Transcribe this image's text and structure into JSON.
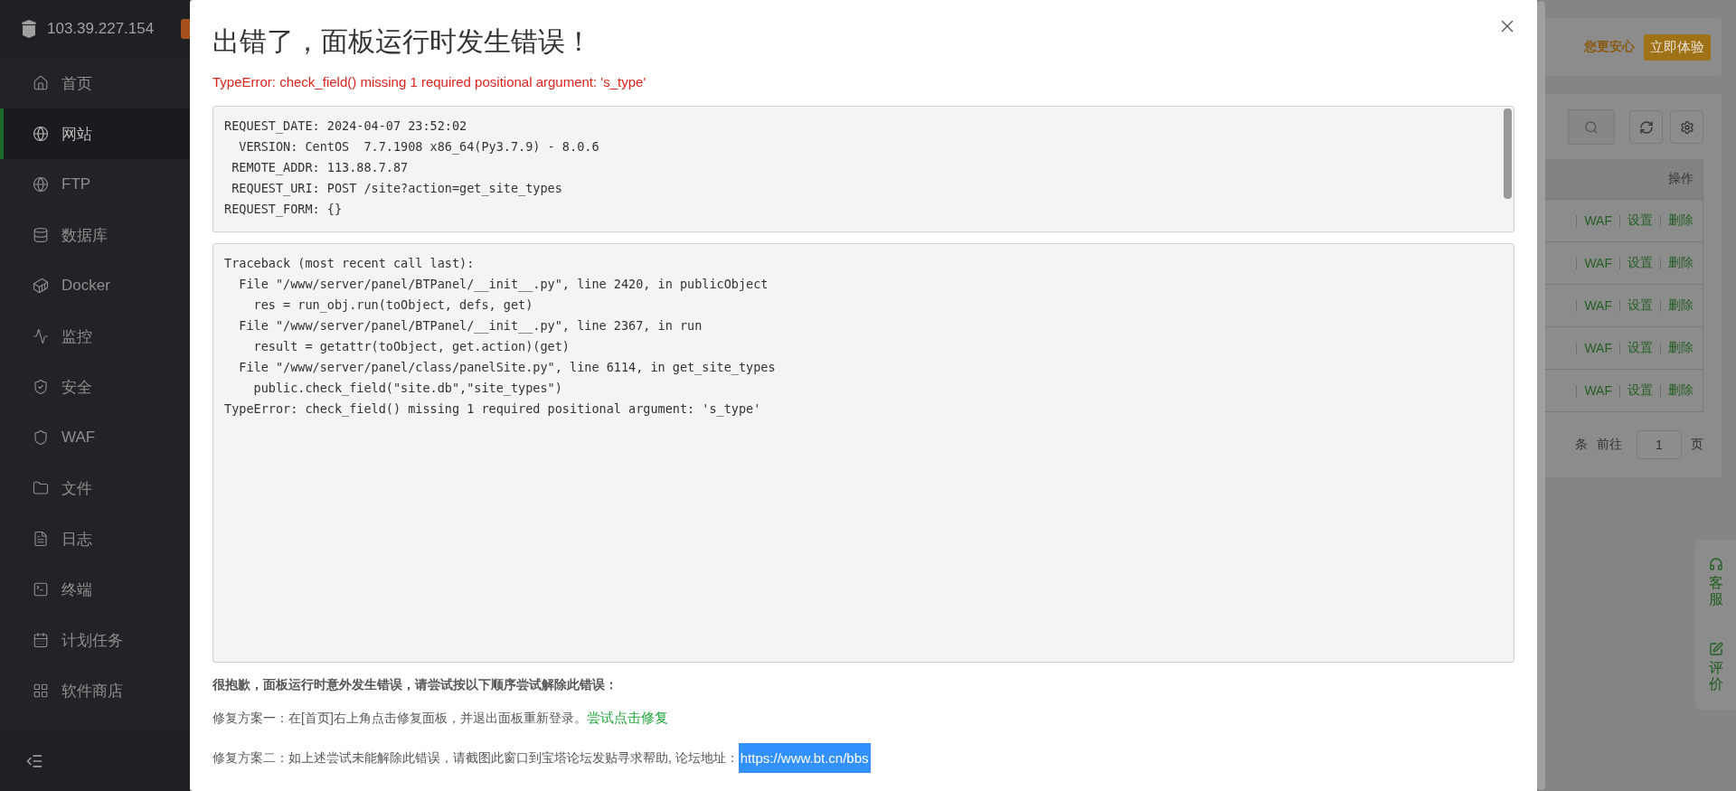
{
  "sidebar": {
    "host": "103.39.227.154",
    "items": [
      {
        "label": "首页",
        "selected": false
      },
      {
        "label": "网站",
        "selected": true
      },
      {
        "label": "FTP",
        "selected": false
      },
      {
        "label": "数据库",
        "selected": false
      },
      {
        "label": "Docker",
        "selected": false
      },
      {
        "label": "监控",
        "selected": false
      },
      {
        "label": "安全",
        "selected": false
      },
      {
        "label": "WAF",
        "selected": false
      },
      {
        "label": "文件",
        "selected": false
      },
      {
        "label": "日志",
        "selected": false
      },
      {
        "label": "终端",
        "selected": false
      },
      {
        "label": "计划任务",
        "selected": false
      },
      {
        "label": "软件商店",
        "selected": false
      }
    ]
  },
  "banner": {
    "text": "您更安心",
    "button": "立即体验"
  },
  "table": {
    "header": "操作",
    "rows": [
      {
        "actions": [
          "WAF",
          "设置",
          "删除"
        ]
      },
      {
        "actions": [
          "WAF",
          "设置",
          "删除"
        ]
      },
      {
        "actions": [
          "WAF",
          "设置",
          "删除"
        ]
      },
      {
        "actions": [
          "WAF",
          "设置",
          "删除"
        ]
      },
      {
        "actions": [
          "WAF",
          "设置",
          "删除"
        ]
      }
    ]
  },
  "pagination": {
    "unit": "条",
    "goto": "前往",
    "page": "1",
    "page_suffix": "页"
  },
  "float_panel": [
    {
      "label": "客服"
    },
    {
      "label": "评价"
    }
  ],
  "modal": {
    "title": "出错了，面板运行时发生错误！",
    "error": "TypeError: check_field() missing 1 required positional argument: 's_type'",
    "request_info": [
      "REQUEST_DATE: 2024-04-07 23:52:02",
      "  VERSION: CentOS  7.7.1908 x86_64(Py3.7.9) - 8.0.6",
      " REMOTE_ADDR: 113.88.7.87",
      " REQUEST_URI: POST /site?action=get_site_types",
      "REQUEST_FORM: {}"
    ],
    "traceback": [
      "Traceback (most recent call last):",
      "  File \"/www/server/panel/BTPanel/__init__.py\", line 2420, in publicObject",
      "    res = run_obj.run(toObject, defs, get)",
      "  File \"/www/server/panel/BTPanel/__init__.py\", line 2367, in run",
      "    result = getattr(toObject, get.action)(get)",
      "  File \"/www/server/panel/class/panelSite.py\", line 6114, in get_site_types",
      "    public.check_field(\"site.db\",\"site_types\")",
      "TypeError: check_field() missing 1 required positional argument: 's_type'"
    ],
    "apology": "很抱歉，面板运行时意外发生错误，请尝试按以下顺序尝试解除此错误：",
    "fixes": [
      {
        "text": "修复方案一：在[首页]右上角点击修复面板，并退出面板重新登录。",
        "link": "尝试点击修复",
        "selected": false
      },
      {
        "text": "修复方案二：如上述尝试未能解除此错误，请截图此窗口到宝塔论坛发贴寻求帮助, 论坛地址：",
        "link": "https://www.bt.cn/bbs",
        "selected": true
      }
    ]
  }
}
